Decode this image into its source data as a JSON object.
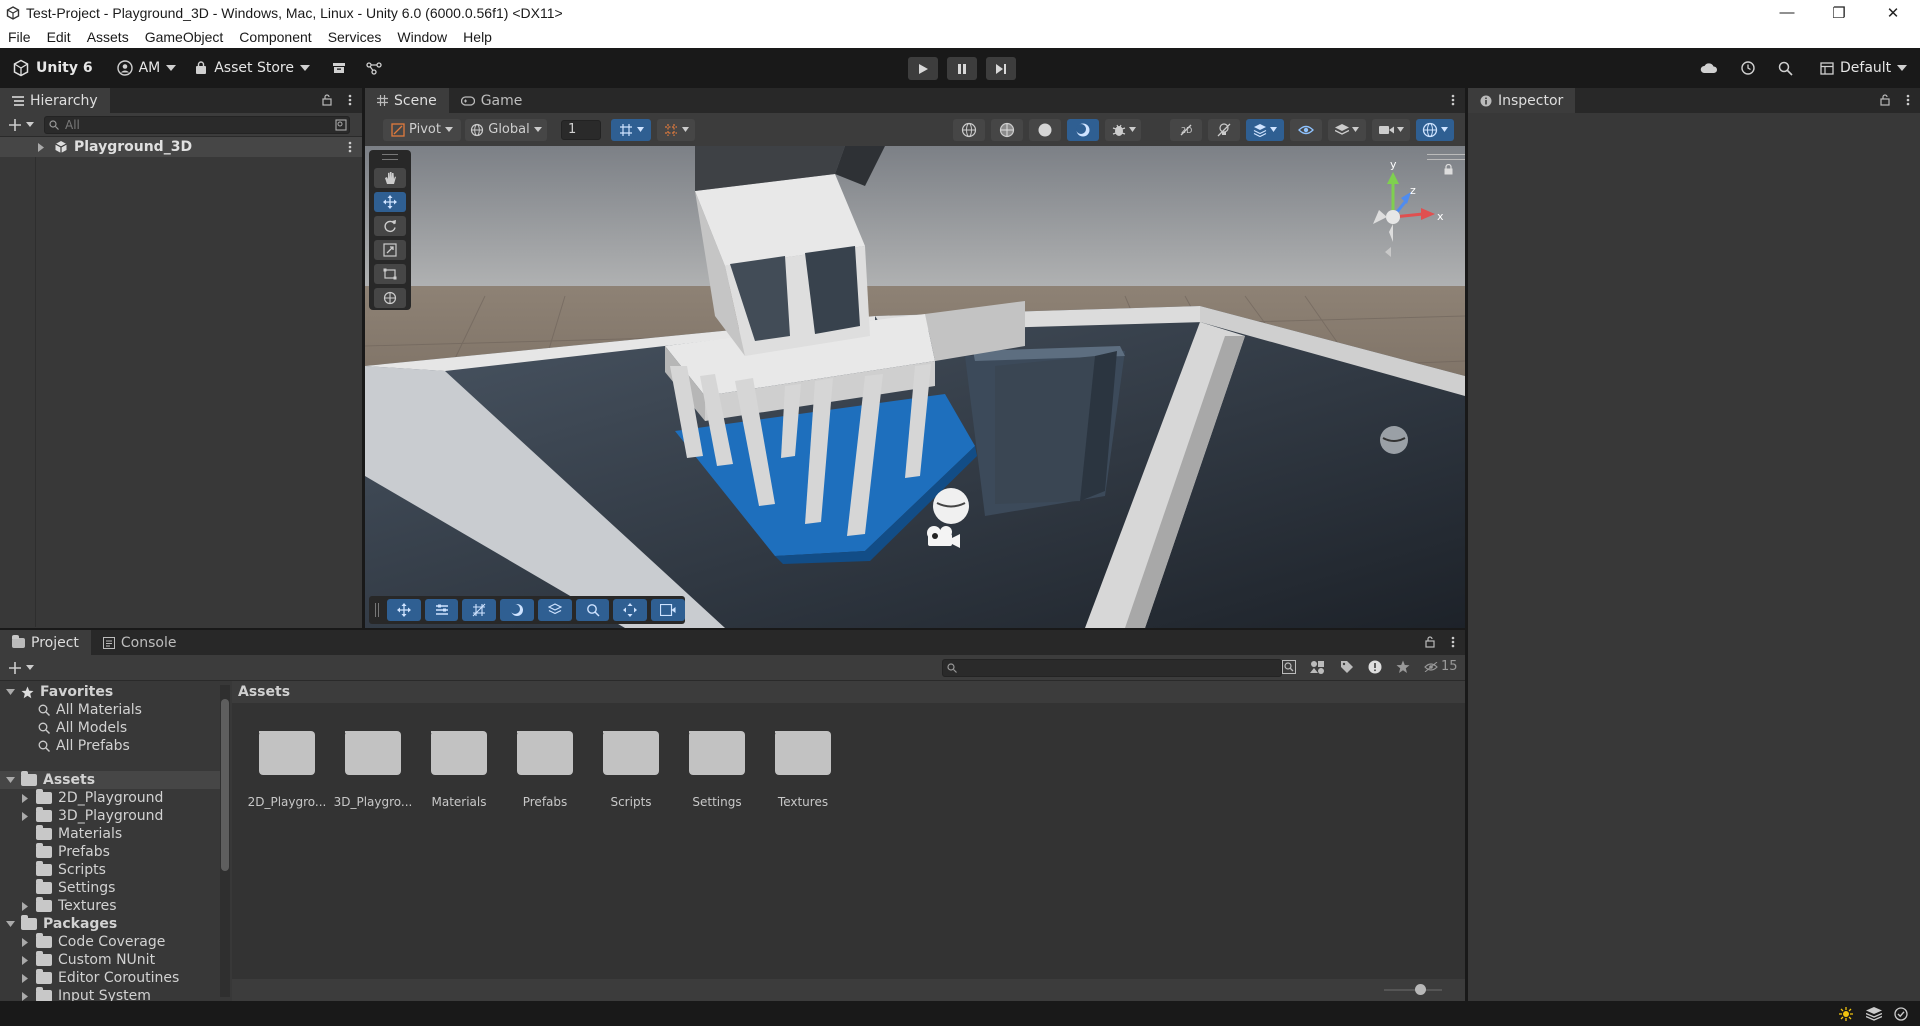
{
  "window": {
    "title": "Test-Project - Playground_3D - Windows, Mac, Linux - Unity 6.0 (6000.0.56f1) <DX11>",
    "minimize": "—",
    "restore": "❐",
    "close": "✕"
  },
  "menu": [
    "File",
    "Edit",
    "Assets",
    "GameObject",
    "Component",
    "Services",
    "Window",
    "Help"
  ],
  "toolbar": {
    "unity_label": "Unity 6",
    "account_label": "AM",
    "asset_store_label": "Asset Store",
    "layout_label": "Default"
  },
  "hierarchy": {
    "tab_label": "Hierarchy",
    "search_placeholder": "All",
    "root_item": "Playground_3D"
  },
  "scene": {
    "tabs": [
      "Scene",
      "Game"
    ],
    "pivot_label": "Pivot",
    "global_label": "Global",
    "grid_snap_value": "1",
    "gizmo_y": "y",
    "gizmo_x": "x",
    "gizmo_z": "z"
  },
  "inspector": {
    "tab_label": "Inspector"
  },
  "project": {
    "tabs": [
      "Project",
      "Console"
    ],
    "breadcrumb": "Assets",
    "hidden_count": "15",
    "favorites": {
      "label": "Favorites",
      "items": [
        "All Materials",
        "All Models",
        "All Prefabs"
      ]
    },
    "assets_tree": {
      "label": "Assets",
      "items": [
        "2D_Playground",
        "3D_Playground",
        "Materials",
        "Prefabs",
        "Scripts",
        "Settings",
        "Textures"
      ]
    },
    "packages_tree": {
      "label": "Packages",
      "items": [
        "Code Coverage",
        "Custom NUnit",
        "Editor Coroutines",
        "Input System"
      ]
    },
    "grid_assets": [
      "2D_Playgro...",
      "3D_Playgro...",
      "Materials",
      "Prefabs",
      "Scripts",
      "Settings",
      "Textures"
    ]
  },
  "colors": {
    "accent": "#3a79bb",
    "panel": "#383838",
    "dark": "#191919"
  }
}
